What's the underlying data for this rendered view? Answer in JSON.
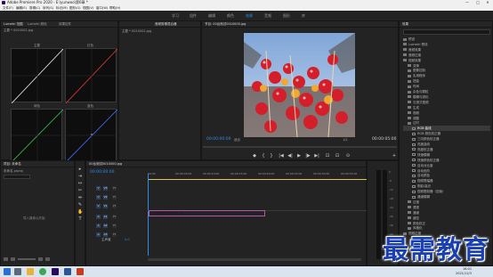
{
  "app": {
    "title": "Adobe Premiere Pro 2020 - E:\\yunwoo\\第6章 *"
  },
  "window_controls": {
    "minimize": "—",
    "maximize": "□",
    "close": "✕"
  },
  "menu": [
    "文件(F)",
    "编辑(E)",
    "剪辑(C)",
    "序列(S)",
    "标记(M)",
    "图形(G)",
    "视图(V)",
    "窗口(W)",
    "帮助(H)"
  ],
  "workspaces": {
    "items": [
      "学习",
      "组件",
      "编辑",
      "颜色",
      "效果",
      "音频",
      "图形",
      "库"
    ],
    "active": "效果"
  },
  "lumetri_panel": {
    "tabs": [
      "Lumetri 范围",
      "Lumetri 颜色",
      "效果控件",
      "音频剪辑混合器"
    ],
    "dropdown": "主要 * 0010002.jpg"
  },
  "scopes": {
    "labels": [
      "主要",
      "红色",
      "绿色",
      "蓝色"
    ]
  },
  "effect_controls": {
    "title": "效果控件",
    "source": "主要 * 0010002.jpg"
  },
  "program_monitor": {
    "title": "节目: 00台测试0010000.jpg",
    "timecode_left": "00:00:00:00",
    "fit_label": "适合",
    "ratio": "1/2",
    "timecode_right": "00:00:05:00",
    "controls": [
      "◆",
      "{",
      "}",
      "|◀",
      "◀|",
      "▶",
      "|▶",
      "▶|",
      "⊡",
      "⊡",
      "⊙",
      "+"
    ]
  },
  "project_panel": {
    "title": "项目: 未命名",
    "file": "未命名.prproj",
    "empty_hint": "导入媒体以开始"
  },
  "timeline": {
    "tab": "00台测试0010000.jpg",
    "timecode": "00:00:00:00",
    "ruler": [
      "00:00",
      "00:00:05:00",
      "00:00:10:00",
      "00:00:15:00",
      "00:00:20:00",
      "00:00:25:00",
      "00:00:30:00",
      "00:00:35:00"
    ],
    "tracks": [
      {
        "name": "V3",
        "kind": "video"
      },
      {
        "name": "V2",
        "kind": "video"
      },
      {
        "name": "V1",
        "kind": "video"
      },
      {
        "name": "A1",
        "kind": "audio"
      },
      {
        "name": "A2",
        "kind": "audio"
      },
      {
        "name": "A3",
        "kind": "audio"
      }
    ],
    "master": "主声道",
    "master_value": "0.0",
    "clip_label": "fx 00台测试0010000.jpg",
    "clip_color": "#e08ad4"
  },
  "effects_panel": {
    "title": "效果",
    "items": [
      {
        "label": "预设",
        "type": "folder",
        "indent": 0
      },
      {
        "label": "Lumetri 预设",
        "type": "folder",
        "indent": 0
      },
      {
        "label": "音频效果",
        "type": "folder",
        "indent": 0
      },
      {
        "label": "音频过渡",
        "type": "folder",
        "indent": 0
      },
      {
        "label": "视频效果",
        "type": "folder",
        "indent": 0
      },
      {
        "label": "变换",
        "type": "folder",
        "indent": 1
      },
      {
        "label": "图像控制",
        "type": "folder",
        "indent": 1
      },
      {
        "label": "实用程序",
        "type": "folder",
        "indent": 1
      },
      {
        "label": "扭曲",
        "type": "folder",
        "indent": 1
      },
      {
        "label": "时间",
        "type": "folder",
        "indent": 1
      },
      {
        "label": "杂色与颗粒",
        "type": "folder",
        "indent": 1
      },
      {
        "label": "模糊与锐化",
        "type": "folder",
        "indent": 1
      },
      {
        "label": "沉浸式视频",
        "type": "folder",
        "indent": 1
      },
      {
        "label": "生成",
        "type": "folder",
        "indent": 1
      },
      {
        "label": "视频",
        "type": "folder",
        "indent": 1
      },
      {
        "label": "调整",
        "type": "folder",
        "indent": 1
      },
      {
        "label": "过时",
        "type": "folder",
        "indent": 1
      },
      {
        "label": "RGB 曲线",
        "type": "effect",
        "indent": 2
      },
      {
        "label": "RGB 颜色校正器",
        "type": "effect",
        "indent": 2
      },
      {
        "label": "三向颜色校正器",
        "type": "effect",
        "indent": 2
      },
      {
        "label": "亮度曲线",
        "type": "effect",
        "indent": 2
      },
      {
        "label": "亮度校正器",
        "type": "effect",
        "indent": 2
      },
      {
        "label": "快速模糊",
        "type": "effect",
        "indent": 2
      },
      {
        "label": "快速颜色校正器",
        "type": "effect",
        "indent": 2
      },
      {
        "label": "自动对比度",
        "type": "effect",
        "indent": 2
      },
      {
        "label": "自动色阶",
        "type": "effect",
        "indent": 2
      },
      {
        "label": "自动颜色",
        "type": "effect",
        "indent": 2
      },
      {
        "label": "视频限幅器",
        "type": "effect",
        "indent": 2
      },
      {
        "label": "阴影/高光",
        "type": "effect",
        "indent": 2
      },
      {
        "label": "视频限制器（旧版）",
        "type": "effect",
        "indent": 2
      },
      {
        "label": "通道模糊",
        "type": "effect",
        "indent": 2
      },
      {
        "label": "过渡",
        "type": "folder",
        "indent": 1
      },
      {
        "label": "透视",
        "type": "folder",
        "indent": 1
      },
      {
        "label": "通道",
        "type": "folder",
        "indent": 1
      },
      {
        "label": "键控",
        "type": "folder",
        "indent": 1
      },
      {
        "label": "颜色校正",
        "type": "folder",
        "indent": 1
      },
      {
        "label": "风格化",
        "type": "folder",
        "indent": 1
      },
      {
        "label": "视频过渡",
        "type": "folder",
        "indent": 0
      }
    ],
    "selected_index": 17,
    "bottom_label": "基本图形"
  },
  "audio_meter": {
    "scale": [
      "0",
      "-6",
      "-12",
      "-18",
      "-24",
      "-30",
      "-36",
      "-42",
      "-48",
      "-54"
    ],
    "unit": "dB"
  },
  "taskbar": {
    "time": "16:01",
    "date": "2021/11/3",
    "apps": [
      "start",
      "search",
      "files",
      "chrome",
      "premiere",
      "word",
      "ppt"
    ]
  },
  "watermark": "最需教育",
  "colors": {
    "accent": "#2d8ceb",
    "clip": "#e08ad4",
    "watermark": "#1a3fae"
  }
}
